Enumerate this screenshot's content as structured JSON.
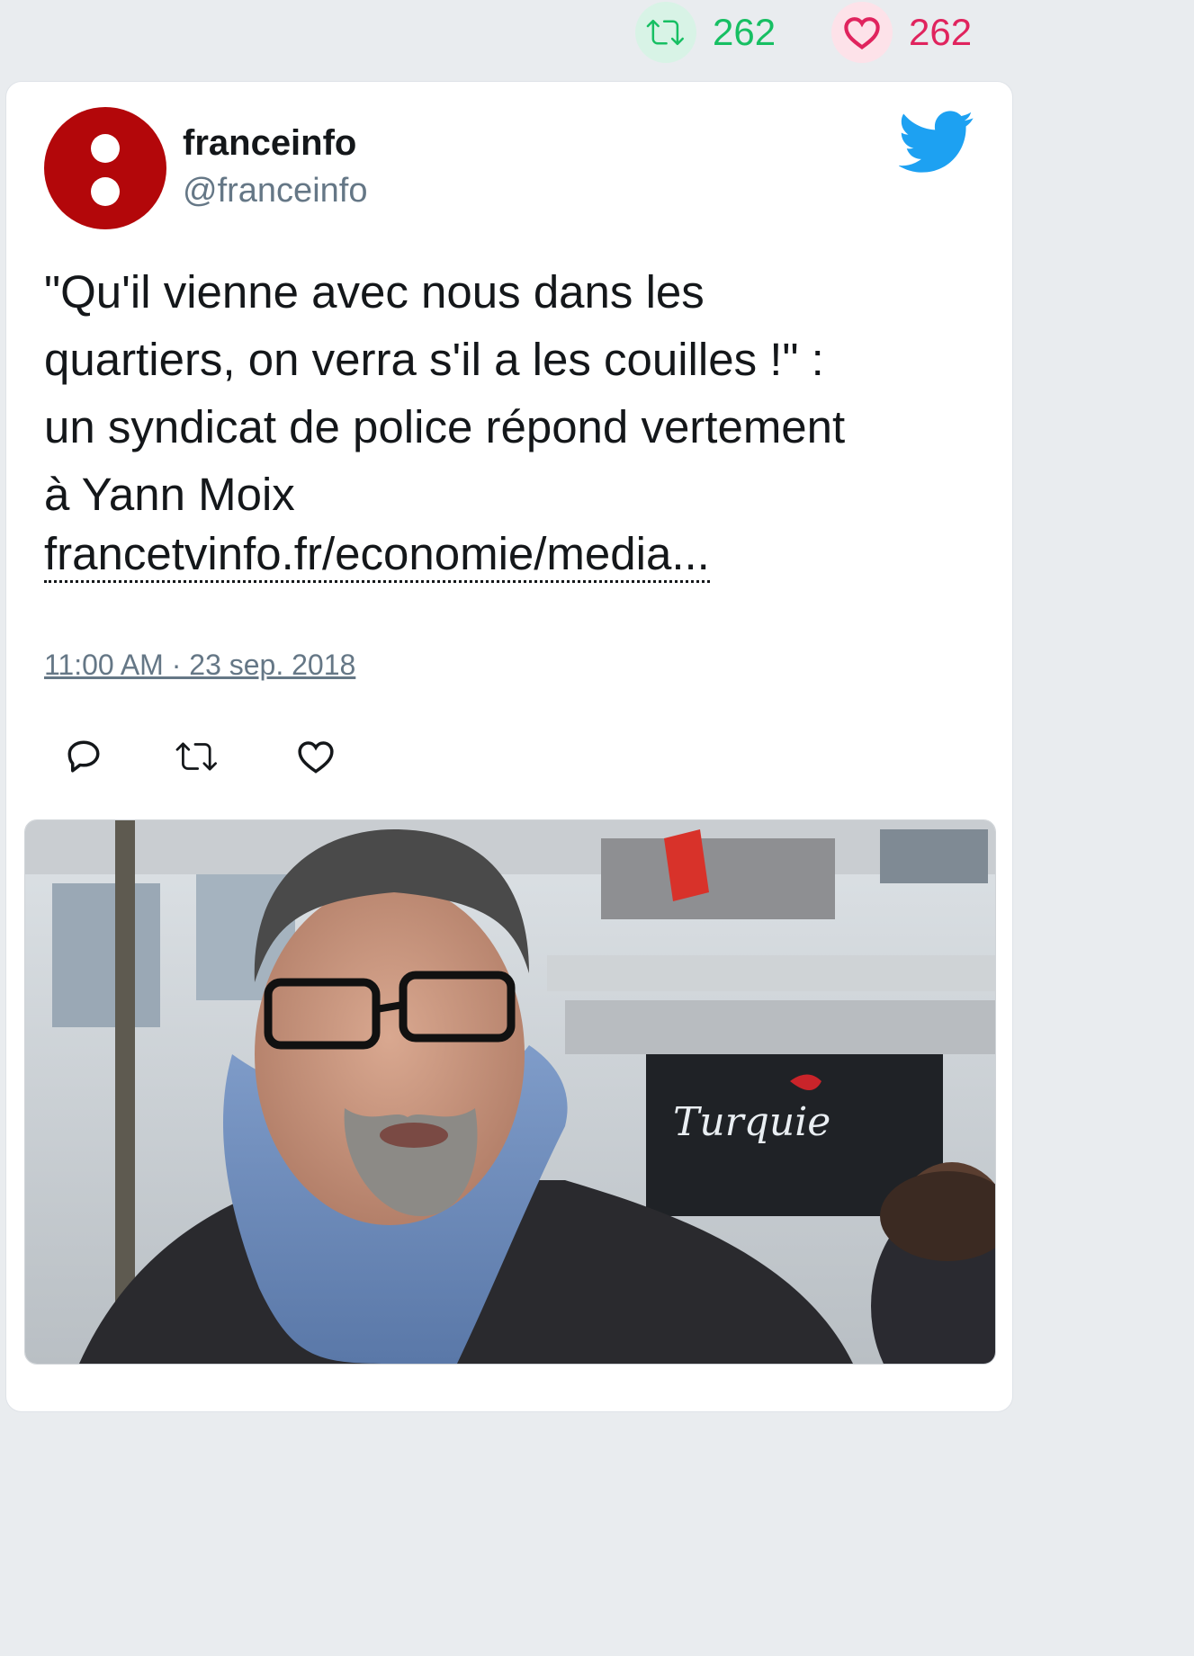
{
  "metrics": {
    "retweets": "262",
    "likes": "262"
  },
  "tweet": {
    "display_name": "franceinfo",
    "handle": "@franceinfo",
    "text_lines": [
      "\"Qu'il vienne avec nous dans les",
      "quartiers, on verra s'il a les couilles !\" :",
      "un syndicat de police répond vertement",
      "à Yann Moix"
    ],
    "link": "francetvinfo.fr/economie/media...",
    "timestamp": "11:00 AM · 23 sep. 2018"
  },
  "photo": {
    "storefront_sign": "Turquie"
  },
  "colors": {
    "retweet_green": "#17bf63",
    "like_red": "#e0245e",
    "twitter_blue": "#1da1f2",
    "avatar_red": "#b3070a"
  }
}
